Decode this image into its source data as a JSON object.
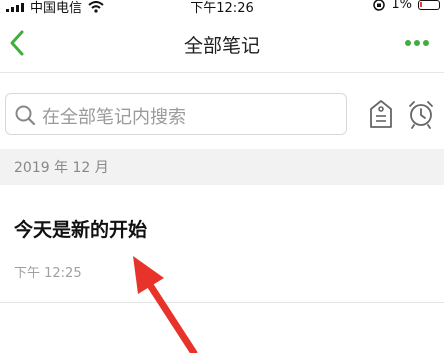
{
  "status_bar": {
    "carrier": "中国电信",
    "time": "下午12:26",
    "battery": "1%"
  },
  "nav": {
    "title": "全部笔记",
    "back_icon": "chevron-left-icon",
    "more_icon": "more-dots-icon"
  },
  "search": {
    "placeholder": "在全部笔记内搜索"
  },
  "toolbar": {
    "tag_icon": "tag-icon",
    "alarm_icon": "alarm-clock-icon"
  },
  "section": {
    "label": "2019 年 12 月"
  },
  "notes": [
    {
      "title": "今天是新的开始",
      "time": "下午 12:25"
    }
  ],
  "colors": {
    "accent_green": "#3fae3f",
    "annotation_red": "#e8332a",
    "section_bg": "#f2f2f2"
  }
}
